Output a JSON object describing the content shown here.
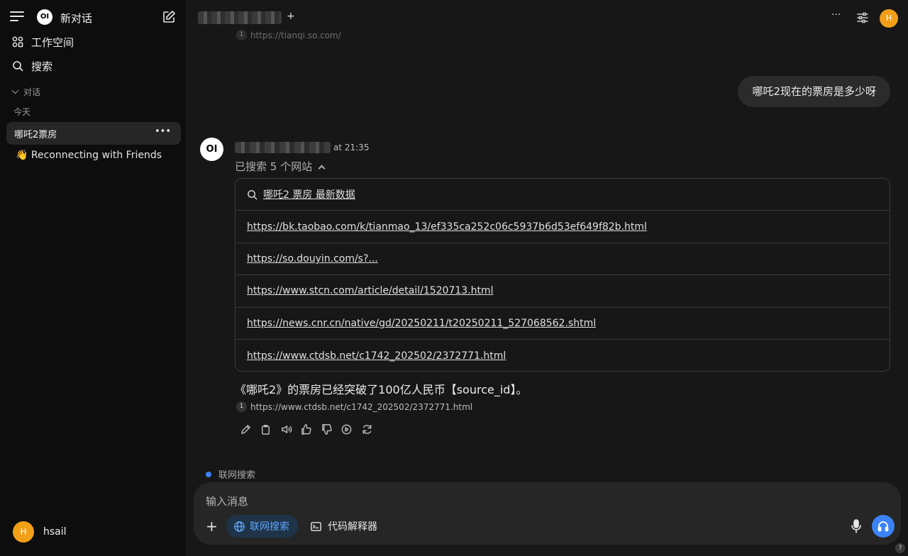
{
  "sidebar": {
    "logo_text": "OI",
    "new_chat": "新对话",
    "workspace": "工作空间",
    "search": "搜索",
    "section_label": "对话",
    "today_label": "今天",
    "chats": [
      {
        "label": "哪吒2票房",
        "more": "•••"
      },
      {
        "label": "👋 Reconnecting with Friends"
      }
    ],
    "user": {
      "initial": "H",
      "name": "hsail"
    }
  },
  "topbar": {
    "plus": "+",
    "more": "···",
    "avatar_initial": "H"
  },
  "conversation": {
    "prev_citation": {
      "num": "1",
      "url": "https://tianqi.so.com/"
    },
    "user_message": "哪吒2现在的票房是多少呀",
    "bot": {
      "avatar_text": "OI",
      "time": "at 21:35",
      "search_summary": "已搜索 5 个网站",
      "query": "哪吒2 票房 最新数据",
      "results": [
        "https://bk.taobao.com/k/tianmao_13/ef335ca252c06c5937b6d53ef649f82b.html",
        "https://so.douyin.com/s?...",
        "https://www.stcn.com/article/detail/1520713.html",
        "https://news.cnr.cn/native/gd/20250211/t20250211_527068562.shtml",
        "https://www.ctdsb.net/c1742_202502/2372771.html"
      ],
      "answer": "《哪吒2》的票房已经突破了100亿人民币【source_id】。",
      "citation": {
        "num": "1",
        "url": "https://www.ctdsb.net/c1742_202502/2372771.html"
      }
    }
  },
  "input": {
    "web_search_status": "联网搜索",
    "placeholder": "输入消息",
    "plus": "+",
    "web_search_chip": "联网搜索",
    "code_interpreter_chip": "代码解释器",
    "help": "?"
  },
  "colors": {
    "accent_blue": "#3b82f6",
    "avatar_orange": "#f29f18"
  }
}
